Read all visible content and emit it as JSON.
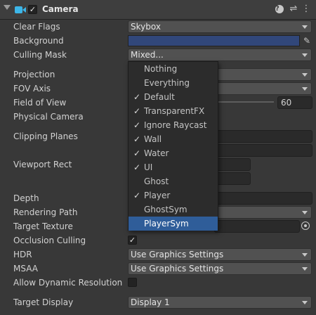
{
  "component": {
    "title": "Camera",
    "enabled": true
  },
  "header_icons": {
    "help": "?",
    "preset": "⇌",
    "more": "⋮"
  },
  "fields": {
    "clear_flags": {
      "label": "Clear Flags",
      "value": "Skybox"
    },
    "background": {
      "label": "Background",
      "color": "#31477a"
    },
    "culling_mask": {
      "label": "Culling Mask",
      "value": "Mixed..."
    },
    "projection": {
      "label": "Projection"
    },
    "fov_axis": {
      "label": "FOV Axis"
    },
    "field_of_view": {
      "label": "Field of View",
      "value": "60"
    },
    "physical_camera": {
      "label": "Physical Camera"
    },
    "clipping_planes": {
      "label": "Clipping Planes"
    },
    "viewport_rect": {
      "label": "Viewport Rect"
    },
    "depth": {
      "label": "Depth"
    },
    "rendering_path": {
      "label": "Rendering Path"
    },
    "target_texture": {
      "label": "Target Texture"
    },
    "occlusion_culling": {
      "label": "Occlusion Culling",
      "checked": true
    },
    "hdr": {
      "label": "HDR",
      "value": "Use Graphics Settings"
    },
    "msaa": {
      "label": "MSAA",
      "value": "Use Graphics Settings"
    },
    "allow_dynamic_resolution": {
      "label": "Allow Dynamic Resolution",
      "checked": false
    },
    "target_display": {
      "label": "Target Display",
      "value": "Display 1"
    }
  },
  "culling_menu": [
    {
      "label": "Nothing",
      "checked": false
    },
    {
      "label": "Everything",
      "checked": false
    },
    {
      "label": "Default",
      "checked": true
    },
    {
      "label": "TransparentFX",
      "checked": true
    },
    {
      "label": "Ignore Raycast",
      "checked": true
    },
    {
      "label": "Wall",
      "checked": true
    },
    {
      "label": "Water",
      "checked": true
    },
    {
      "label": "UI",
      "checked": true
    },
    {
      "label": "Ghost",
      "checked": false
    },
    {
      "label": "Player",
      "checked": true
    },
    {
      "label": "GhostSym",
      "checked": false
    },
    {
      "label": "PlayerSym",
      "checked": false,
      "highlighted": true
    }
  ],
  "check_glyph": "✓",
  "colors": {
    "accent": "#2f5d99",
    "component_icon": "#3db6e8"
  }
}
